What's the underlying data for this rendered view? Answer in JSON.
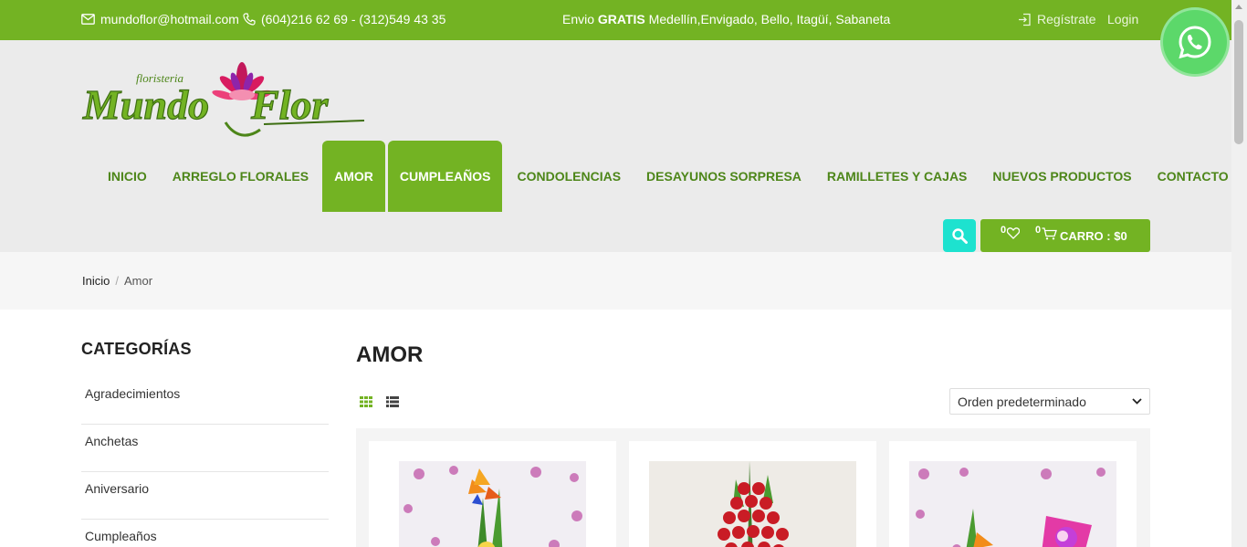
{
  "topbar": {
    "email": "mundoflor@hotmail.com",
    "phone": "(604)216 62 69 - (312)549 43 35",
    "promo_prefix": "Envio",
    "promo_bold": "GRATIS",
    "promo_suffix": "Medellín,Envigado, Bello, Itagüí, Sabaneta",
    "register": "Regístrate",
    "login": "Login"
  },
  "logo": {
    "small_text": "floristeria",
    "brand_left": "Mundo",
    "brand_right": "Flor"
  },
  "nav": [
    {
      "label": "INICIO",
      "active": false
    },
    {
      "label": "ARREGLO FLORALES",
      "active": false
    },
    {
      "label": "AMOR",
      "active": true
    },
    {
      "label": "CUMPLEAÑOS",
      "active": true
    },
    {
      "label": "CONDOLENCIAS",
      "active": false
    },
    {
      "label": "DESAYUNOS SORPRESA",
      "active": false
    },
    {
      "label": "RAMILLETES Y CAJAS",
      "active": false
    },
    {
      "label": "NUEVOS PRODUCTOS",
      "active": false
    },
    {
      "label": "CONTACTO",
      "active": false
    }
  ],
  "cart": {
    "wishlist_count": "0",
    "cart_count": "0",
    "label": "CARRO : $0"
  },
  "breadcrumb": {
    "home": "Inicio",
    "separator": "/",
    "current": "Amor"
  },
  "sidebar": {
    "title": "CATEGORÍAS",
    "items": [
      "Agradecimientos",
      "Anchetas",
      "Aniversario",
      "Cumpleaños"
    ]
  },
  "main": {
    "title": "AMOR",
    "sort_selected": "Orden predeterminado"
  },
  "colors": {
    "primary_green": "#73b323",
    "nav_text_green": "#4d8619",
    "search_teal": "#1de2cf",
    "whatsapp_green": "#5cd86a"
  },
  "icons": {
    "email": "envelope-icon",
    "phone": "phone-icon",
    "register": "sign-in-icon",
    "search": "search-icon",
    "wishlist": "heart-icon",
    "cart": "cart-icon",
    "grid_view": "grid-icon",
    "list_view": "list-icon",
    "whatsapp": "whatsapp-icon"
  }
}
